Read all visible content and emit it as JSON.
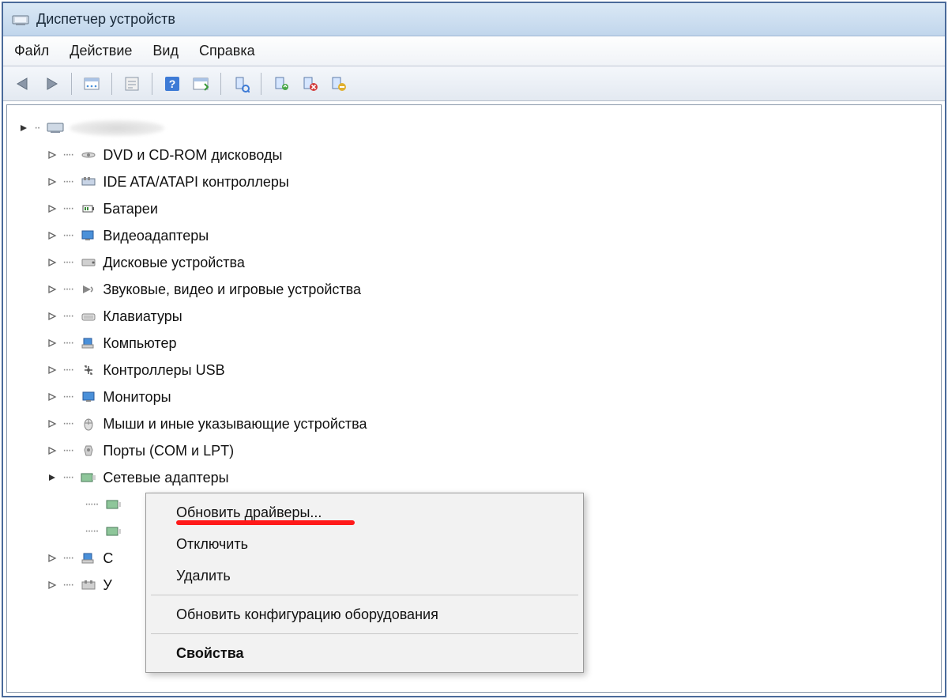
{
  "window": {
    "title": "Диспетчер устройств"
  },
  "menu": {
    "file": "Файл",
    "action": "Действие",
    "view": "Вид",
    "help": "Справка"
  },
  "tree": {
    "root": "",
    "items": [
      {
        "label": "DVD и CD-ROM дисководы"
      },
      {
        "label": "IDE ATA/ATAPI контроллеры"
      },
      {
        "label": "Батареи"
      },
      {
        "label": "Видеоадаптеры"
      },
      {
        "label": "Дисковые устройства"
      },
      {
        "label": "Звуковые, видео и игровые устройства"
      },
      {
        "label": "Клавиатуры"
      },
      {
        "label": "Компьютер"
      },
      {
        "label": "Контроллеры USB"
      },
      {
        "label": "Мониторы"
      },
      {
        "label": "Мыши и иные указывающие устройства"
      },
      {
        "label": "Порты (COM и LPT)"
      },
      {
        "label": "Сетевые адаптеры",
        "expanded": true
      }
    ],
    "truncated": [
      {
        "label": "С"
      },
      {
        "label": "У"
      }
    ]
  },
  "context_menu": {
    "update": "Обновить драйверы...",
    "disable": "Отключить",
    "delete": "Удалить",
    "rescan": "Обновить конфигурацию оборудования",
    "properties": "Свойства"
  }
}
